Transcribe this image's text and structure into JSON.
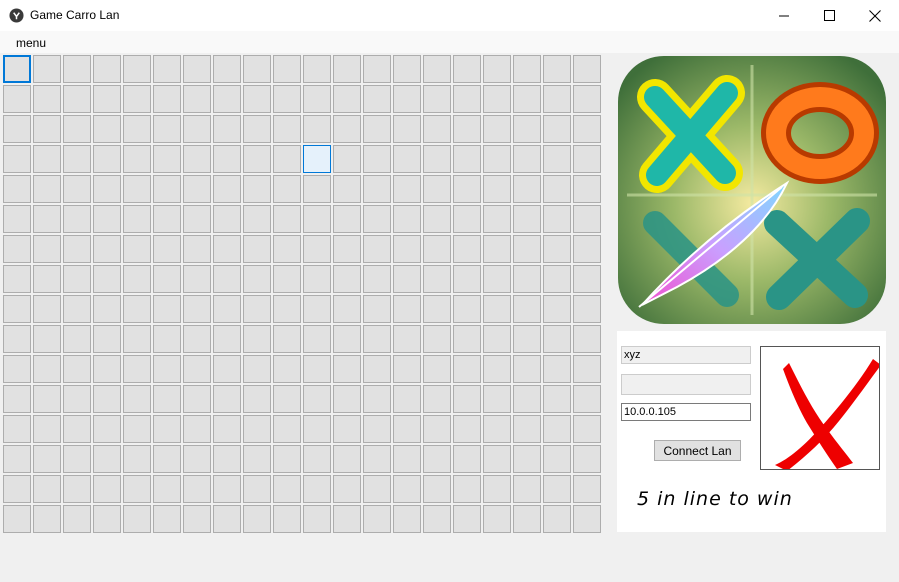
{
  "window": {
    "title": "Game Carro Lan",
    "icon": "app-icon",
    "controls": [
      "minimize-icon",
      "maximize-icon",
      "close-icon"
    ]
  },
  "menubar": {
    "items": [
      {
        "label": "menu"
      }
    ]
  },
  "board": {
    "columns": 20,
    "rows": 16,
    "focused_cell": {
      "row": 0,
      "col": 0
    },
    "hovered_cell": {
      "row": 3,
      "col": 10
    }
  },
  "logo": {
    "icon": "xo-game-logo"
  },
  "connection": {
    "name_value": "xyz",
    "second_value": "",
    "ip_value": "10.0.0.105",
    "connect_label": "Connect Lan"
  },
  "turn_indicator": {
    "icon": "red-x-icon",
    "color": "#ee0000"
  },
  "slogan": "5 in line to win",
  "colors": {
    "cell_bg": "#e1e1e1",
    "cell_border": "#adadad",
    "focus_accent": "#0078d7",
    "hover_bg": "#e5f1fb"
  }
}
